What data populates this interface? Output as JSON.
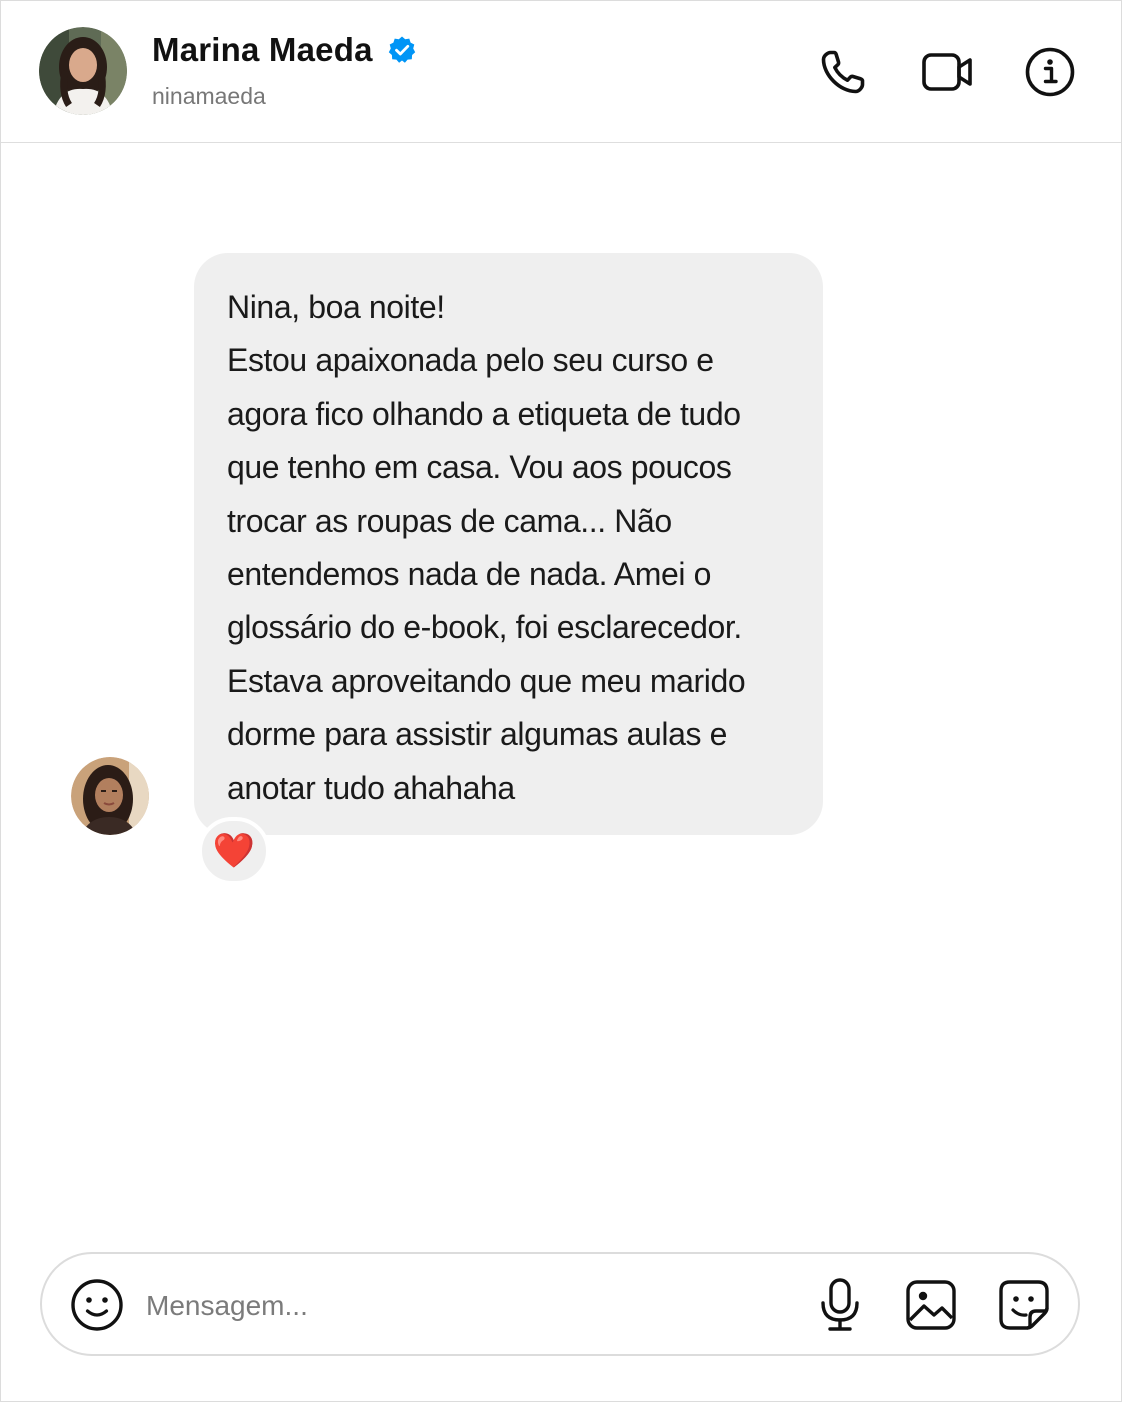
{
  "header": {
    "name": "Marina Maeda",
    "handle": "ninamaeda",
    "verified": true,
    "icons": [
      "phone-icon",
      "video-camera-icon",
      "info-icon"
    ]
  },
  "messages": [
    {
      "text": "Nina, boa noite!\nEstou apaixonada pelo seu curso e\nagora fico olhando a etiqueta de tudo\nque tenho em casa. Vou aos poucos\ntrocar as roupas de cama... Não\nentendemos nada de nada. Amei o\nglossário do e-book, foi esclarecedor.\nEstava aproveitando que meu marido\ndorme para assistir algumas aulas e\nanotar tudo ahahaha",
      "reaction": "❤️"
    }
  ],
  "composer": {
    "placeholder": "Mensagem...",
    "icons": [
      "emoji-icon",
      "microphone-icon",
      "image-icon",
      "sticker-icon"
    ]
  },
  "colors": {
    "bubble": "#efefef",
    "verified": "#0095f6",
    "icon": "#111111",
    "muted_text": "#777777"
  }
}
